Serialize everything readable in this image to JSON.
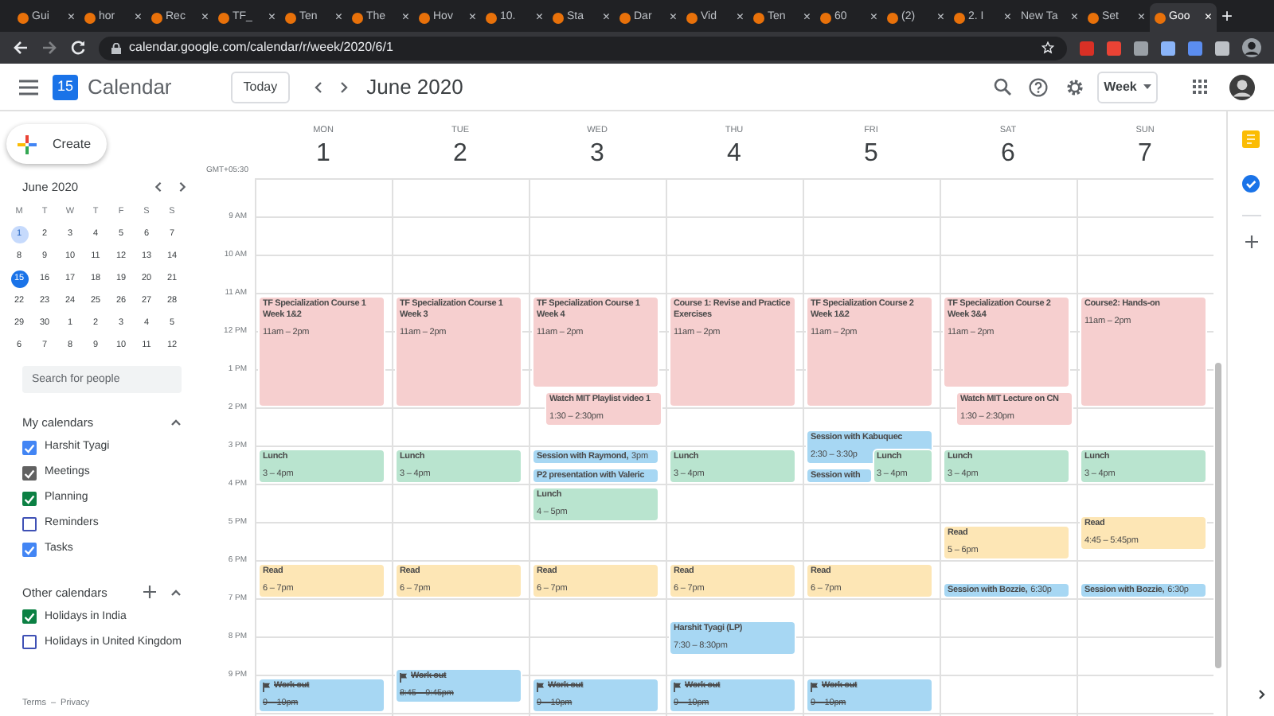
{
  "browser": {
    "tabs": [
      {
        "label": "Gui",
        "selected": false,
        "has_icon": true
      },
      {
        "label": "hor",
        "selected": false,
        "has_icon": true
      },
      {
        "label": "Rec",
        "selected": false,
        "has_icon": true
      },
      {
        "label": "TF_",
        "selected": false,
        "has_icon": true
      },
      {
        "label": "Ten",
        "selected": false,
        "has_icon": true
      },
      {
        "label": "The",
        "selected": false,
        "has_icon": true
      },
      {
        "label": "Hov",
        "selected": false,
        "has_icon": true
      },
      {
        "label": "10.",
        "selected": false,
        "has_icon": true
      },
      {
        "label": "Sta",
        "selected": false,
        "has_icon": true
      },
      {
        "label": "Dar",
        "selected": false,
        "has_icon": true
      },
      {
        "label": "Vid",
        "selected": false,
        "has_icon": true
      },
      {
        "label": "Ten",
        "selected": false,
        "has_icon": true
      },
      {
        "label": "60",
        "selected": false,
        "has_icon": true
      },
      {
        "label": "(2)",
        "selected": false,
        "has_icon": true
      },
      {
        "label": "2. I",
        "selected": false,
        "has_icon": true
      },
      {
        "label": "New Ta",
        "selected": false,
        "has_icon": false
      },
      {
        "label": "Set",
        "selected": false,
        "has_icon": true
      },
      {
        "label": "Goo",
        "selected": true,
        "has_icon": true
      }
    ],
    "close_glyph": "×",
    "new_tab_glyph": "+",
    "url": "calendar.google.com/calendar/r/week/2020/6/1"
  },
  "header": {
    "logo": "15",
    "app_name": "Calendar",
    "today_button": "Today",
    "period": "June 2020",
    "view_button": "Week"
  },
  "sidebar": {
    "create_button": "Create",
    "mini_calendar": {
      "title": "June 2020",
      "weekdays": [
        "M",
        "T",
        "W",
        "T",
        "F",
        "S",
        "S"
      ],
      "days": [
        {
          "label": "1",
          "selected": true,
          "today": false
        },
        {
          "label": "2",
          "selected": false,
          "today": false
        },
        {
          "label": "3",
          "selected": false,
          "today": false
        },
        {
          "label": "4",
          "selected": false,
          "today": false
        },
        {
          "label": "5",
          "selected": false,
          "today": false
        },
        {
          "label": "6",
          "selected": false,
          "today": false
        },
        {
          "label": "7",
          "selected": false,
          "today": false
        },
        {
          "label": "8",
          "selected": false,
          "today": false
        },
        {
          "label": "9",
          "selected": false,
          "today": false
        },
        {
          "label": "10",
          "selected": false,
          "today": false
        },
        {
          "label": "11",
          "selected": false,
          "today": false
        },
        {
          "label": "12",
          "selected": false,
          "today": false
        },
        {
          "label": "13",
          "selected": false,
          "today": false
        },
        {
          "label": "14",
          "selected": false,
          "today": false
        },
        {
          "label": "15",
          "selected": false,
          "today": true
        },
        {
          "label": "16",
          "selected": false,
          "today": false
        },
        {
          "label": "17",
          "selected": false,
          "today": false
        },
        {
          "label": "18",
          "selected": false,
          "today": false
        },
        {
          "label": "19",
          "selected": false,
          "today": false
        },
        {
          "label": "20",
          "selected": false,
          "today": false
        },
        {
          "label": "21",
          "selected": false,
          "today": false
        },
        {
          "label": "22",
          "selected": false,
          "today": false
        },
        {
          "label": "23",
          "selected": false,
          "today": false
        },
        {
          "label": "24",
          "selected": false,
          "today": false
        },
        {
          "label": "25",
          "selected": false,
          "today": false
        },
        {
          "label": "26",
          "selected": false,
          "today": false
        },
        {
          "label": "27",
          "selected": false,
          "today": false
        },
        {
          "label": "28",
          "selected": false,
          "today": false
        },
        {
          "label": "29",
          "selected": false,
          "today": false
        },
        {
          "label": "30",
          "selected": false,
          "today": false
        },
        {
          "label": "1",
          "selected": false,
          "today": false
        },
        {
          "label": "2",
          "selected": false,
          "today": false
        },
        {
          "label": "3",
          "selected": false,
          "today": false
        },
        {
          "label": "4",
          "selected": false,
          "today": false
        },
        {
          "label": "5",
          "selected": false,
          "today": false
        },
        {
          "label": "6",
          "selected": false,
          "today": false
        },
        {
          "label": "7",
          "selected": false,
          "today": false
        },
        {
          "label": "8",
          "selected": false,
          "today": false
        },
        {
          "label": "9",
          "selected": false,
          "today": false
        },
        {
          "label": "10",
          "selected": false,
          "today": false
        },
        {
          "label": "11",
          "selected": false,
          "today": false
        },
        {
          "label": "12",
          "selected": false,
          "today": false
        }
      ]
    },
    "search": {
      "placeholder": "Search for people"
    },
    "my_calendars": {
      "title": "My calendars",
      "items": [
        {
          "label": "Harshit Tyagi",
          "checked": true,
          "color": "#4285f4"
        },
        {
          "label": "Meetings",
          "checked": true,
          "color": "#616161"
        },
        {
          "label": "Planning",
          "checked": true,
          "color": "#0b8043"
        },
        {
          "label": "Reminders",
          "checked": false,
          "color": "#3f51b5"
        },
        {
          "label": "Tasks",
          "checked": true,
          "color": "#4285f4"
        }
      ]
    },
    "other_calendars": {
      "title": "Other calendars",
      "items": [
        {
          "label": "Holidays in India",
          "checked": true,
          "color": "#0b8043"
        },
        {
          "label": "Holidays in United Kingdom",
          "checked": false,
          "color": "#3f51b5"
        }
      ]
    },
    "footer": {
      "links": [
        "Terms",
        "Privacy"
      ],
      "separator": "–"
    }
  },
  "week": {
    "timezone": "GMT+05:30",
    "time_labels": [
      "9 AM",
      "10 AM",
      "11 AM",
      "12 PM",
      "1 PM",
      "2 PM",
      "3 PM",
      "4 PM",
      "5 PM",
      "6 PM",
      "7 PM",
      "8 PM",
      "9 PM"
    ],
    "days": [
      {
        "weekday": "MON",
        "date": "1",
        "events": [
          {
            "title": "TF Specialization Course 1 Week 1&2",
            "time": "11am – 2pm",
            "color": "#f6cfcf",
            "done": false
          },
          {
            "title": "Lunch",
            "time": "3 – 4pm",
            "color": "#b9e4cf",
            "done": false
          },
          {
            "title": "Read",
            "time": "6 – 7pm",
            "color": "#fde6b5",
            "done": false
          },
          {
            "title": "Work out",
            "time": "9 – 10pm",
            "color": "#a7d7f3",
            "done": true
          }
        ]
      },
      {
        "weekday": "TUE",
        "date": "2",
        "events": [
          {
            "title": "TF Specialization Course 1 Week 3",
            "time": "11am – 2pm",
            "color": "#f6cfcf",
            "done": false
          },
          {
            "title": "Lunch",
            "time": "3 – 4pm",
            "color": "#b9e4cf",
            "done": false
          },
          {
            "title": "Read",
            "time": "6 – 7pm",
            "color": "#fde6b5",
            "done": false
          },
          {
            "title": "Work out",
            "time": "8:45 – 9:45pm",
            "color": "#a7d7f3",
            "done": true
          }
        ]
      },
      {
        "weekday": "WED",
        "date": "3",
        "events": [
          {
            "title": "TF Specialization Course 1 Week 4",
            "time": "11am – 2pm",
            "color": "#f6cfcf",
            "done": false
          },
          {
            "title": "Watch MIT Playlist video 1",
            "time": "1:30 – 2:30pm",
            "color": "#f6cfcf",
            "done": false
          },
          {
            "title": "Session with Raymond,",
            "time": "3pm",
            "color": "#a7d7f3",
            "done": false
          },
          {
            "title": "P2 presentation with Valeric",
            "color": "#a7d7f3",
            "done": false
          },
          {
            "title": "Lunch",
            "time": "4 – 5pm",
            "color": "#b9e4cf",
            "done": false
          },
          {
            "title": "Read",
            "time": "6 – 7pm",
            "color": "#fde6b5",
            "done": false
          },
          {
            "title": "Work out",
            "time": "9 – 10pm",
            "color": "#a7d7f3",
            "done": true
          }
        ]
      },
      {
        "weekday": "THU",
        "date": "4",
        "events": [
          {
            "title": "Course 1: Revise and Practice Exercises",
            "time": "11am – 2pm",
            "color": "#f6cfcf",
            "done": false
          },
          {
            "title": "Lunch",
            "time": "3 – 4pm",
            "color": "#b9e4cf",
            "done": false
          },
          {
            "title": "Read",
            "time": "6 – 7pm",
            "color": "#fde6b5",
            "done": false
          },
          {
            "title": "Harshit Tyagi (LP)",
            "time": "7:30 – 8:30pm",
            "color": "#a7d7f3",
            "done": false
          },
          {
            "title": "Work out",
            "time": "9 – 10pm",
            "color": "#a7d7f3",
            "done": true
          }
        ]
      },
      {
        "weekday": "FRI",
        "date": "5",
        "events": [
          {
            "title": "TF Specialization Course 2 Week 1&2",
            "time": "11am – 2pm",
            "color": "#f6cfcf",
            "done": false
          },
          {
            "title": "Session with Kabuquec",
            "time": "2:30 – 3:30p",
            "color": "#a7d7f3",
            "done": false
          },
          {
            "title": "Session with",
            "color": "#a7d7f3",
            "done": false
          },
          {
            "title": "Lunch",
            "time": "3 – 4pm",
            "color": "#b9e4cf",
            "done": false
          },
          {
            "title": "Read",
            "time": "6 – 7pm",
            "color": "#fde6b5",
            "done": false
          },
          {
            "title": "Work out",
            "time": "9 – 10pm",
            "color": "#a7d7f3",
            "done": true
          }
        ]
      },
      {
        "weekday": "SAT",
        "date": "6",
        "events": [
          {
            "title": "TF Specialization Course 2 Week 3&4",
            "time": "11am – 2pm",
            "color": "#f6cfcf",
            "done": false
          },
          {
            "title": "Watch MIT Lecture on CN",
            "time": "1:30 – 2:30pm",
            "color": "#f6cfcf",
            "done": false
          },
          {
            "title": "Lunch",
            "time": "3 – 4pm",
            "color": "#b9e4cf",
            "done": false
          },
          {
            "title": "Read",
            "time": "5 – 6pm",
            "color": "#fde6b5",
            "done": false
          },
          {
            "title": "Session with Bozzie,",
            "time": "6:30p",
            "color": "#a7d7f3",
            "done": false
          }
        ]
      },
      {
        "weekday": "SUN",
        "date": "7",
        "events": [
          {
            "title": "Course2: Hands-on",
            "time": "11am – 2pm",
            "color": "#f6cfcf",
            "done": false
          },
          {
            "title": "Lunch",
            "time": "3 – 4pm",
            "color": "#b9e4cf",
            "done": false
          },
          {
            "title": "Read",
            "time": "4:45 – 5:45pm",
            "color": "#fde6b5",
            "done": false
          },
          {
            "title": "Session with Bozzie,",
            "time": "6:30p",
            "color": "#a7d7f3",
            "done": false
          }
        ]
      }
    ]
  }
}
